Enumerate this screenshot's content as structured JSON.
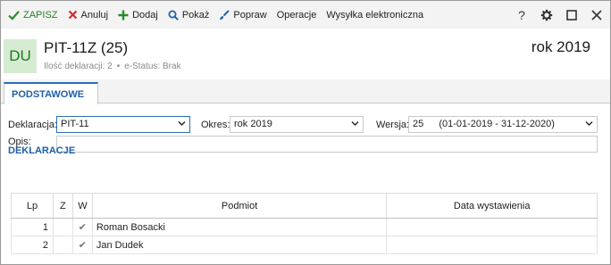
{
  "toolbar": {
    "save_label": "ZAPISZ",
    "cancel_label": "Anuluj",
    "add_label": "Dodaj",
    "show_label": "Pokaż",
    "fix_label": "Popraw",
    "operations_label": "Operacje",
    "eship_label": "Wysyłka elektroniczna",
    "help_label": "?"
  },
  "header": {
    "badge": "DU",
    "title": "PIT-11Z (25)",
    "count_text": "Ilość deklaracji: 2",
    "separator": "•",
    "status_text": "e-Status: Brak",
    "year": "rok 2019"
  },
  "tabs": [
    {
      "label": "PODSTAWOWE"
    }
  ],
  "form": {
    "declaration_label": "Deklaracja:",
    "declaration_value": "PIT-11",
    "period_label": "Okres:",
    "period_value": "rok 2019",
    "version_label": "Wersja:",
    "version_number": "25",
    "version_range": "(01-01-2019 - 31-12-2020)",
    "desc_label": "Opis:",
    "desc_value": ""
  },
  "declarations": {
    "section_title": "DEKLARACJE",
    "columns": [
      "Lp",
      "Z",
      "W",
      "Podmiot",
      "Data wystawienia"
    ],
    "rows": [
      {
        "lp": "1",
        "z": "",
        "w": "✔",
        "podmiot": "Roman Bosacki",
        "data": ""
      },
      {
        "lp": "2",
        "z": "",
        "w": "✔",
        "podmiot": "Jan Dudek",
        "data": ""
      }
    ]
  },
  "colors": {
    "accent": "#1e5fa8",
    "save_green": "#2a7d2a",
    "cancel_red": "#d42b2b",
    "badge_bg": "#d6ecd2"
  }
}
